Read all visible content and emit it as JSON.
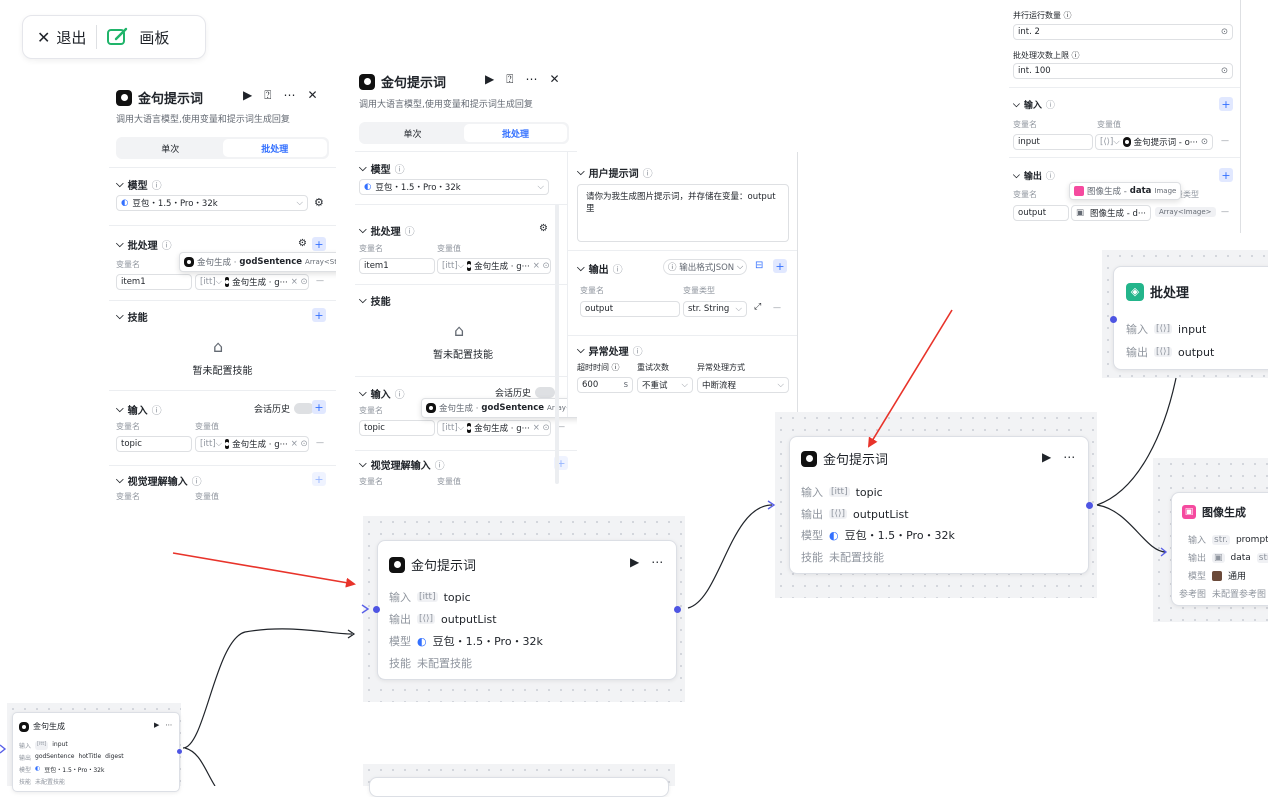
{
  "toolbar": {
    "exit_label": "退出",
    "board_label": "画板"
  },
  "node_title": "金句提示词",
  "node_desc": "调用大语言模型,使用变量和提示词生成回复",
  "tabs": {
    "single": "单次",
    "batch": "批处理"
  },
  "labels": {
    "model": "模型",
    "batch": "批处理",
    "var_name": "变量名",
    "var_value": "变量值",
    "var_type": "变量类型",
    "skills": "技能",
    "no_skills": "暂未配置技能",
    "input": "输入",
    "output": "输出",
    "chat_history": "会话历史",
    "visual_input": "视觉理解输入",
    "user_prompt": "用户提示词",
    "exception": "异常处理",
    "timeout": "超时时间",
    "retry": "重试次数",
    "handle": "异常处理方式",
    "output_format": "输出格式JSON",
    "parallel": "并行运行数量",
    "batch_limit": "批处理次数上限",
    "model_short": "模型",
    "skill_short": "技能",
    "unconfigured_skill": "未配置技能",
    "ref_image": "参考图",
    "unconfigured_ref": "未配置参考图"
  },
  "model_name": "豆包・1.5・Pro・32k",
  "panel1": {
    "batch_var": "item1",
    "input_var": "topic",
    "ref_short": "金句生成 · g···",
    "tooltip_src": "金句生成 ·",
    "tooltip_var": "godSentence",
    "tooltip_type": "Array<String>"
  },
  "panel2": {
    "batch_var": "item1",
    "input_var": "topic",
    "ref_short": "金句生成 · g···",
    "tooltip_src": "金句生成 ·",
    "tooltip_var": "godSentence",
    "tooltip_type": "Array<Str"
  },
  "panel3": {
    "prompt_text": "请你为我生成图片提示词，并存储在变量：output里",
    "output_var": "output",
    "output_type": "str. String",
    "timeout_value": "600",
    "timeout_unit": "s",
    "retry_value": "不重试",
    "handle_value": "中断流程"
  },
  "panel4": {
    "parallel_value": "int. 2",
    "limit_value": "int. 100",
    "input_var": "input",
    "input_ref": "金句提示词 - o···",
    "output_var": "output",
    "output_ref": "图像生成 - d···",
    "output_type": "Array<Image>",
    "tooltip_src": "图像生成 -",
    "tooltip_var": "data",
    "tooltip_type": "Image"
  },
  "node_mid": {
    "title": "金句提示词",
    "input": "topic",
    "output": "outputList",
    "model": "豆包・1.5・Pro・32k"
  },
  "node_right": {
    "title": "金句提示词",
    "input": "topic",
    "output": "outputList",
    "model": "豆包・1.5・Pro・32k"
  },
  "node_batch": {
    "title": "批处理",
    "input": "input",
    "output": "output"
  },
  "node_image": {
    "title": "图像生成",
    "input": "prompt",
    "output": "data",
    "model": "通用"
  },
  "node_small": {
    "title": "金句生成",
    "input": "input",
    "out1": "godSentence",
    "out2": "hotTitle",
    "out3": "digest",
    "model": "豆包・1.5・Pro・32k",
    "skill": "未配置技能"
  },
  "colors": {
    "accent": "#3370ff",
    "port": "#4e55e3",
    "arrow": "#e8332a",
    "batch_icon": "#23b58b",
    "image_icon": "#f54a9f"
  }
}
